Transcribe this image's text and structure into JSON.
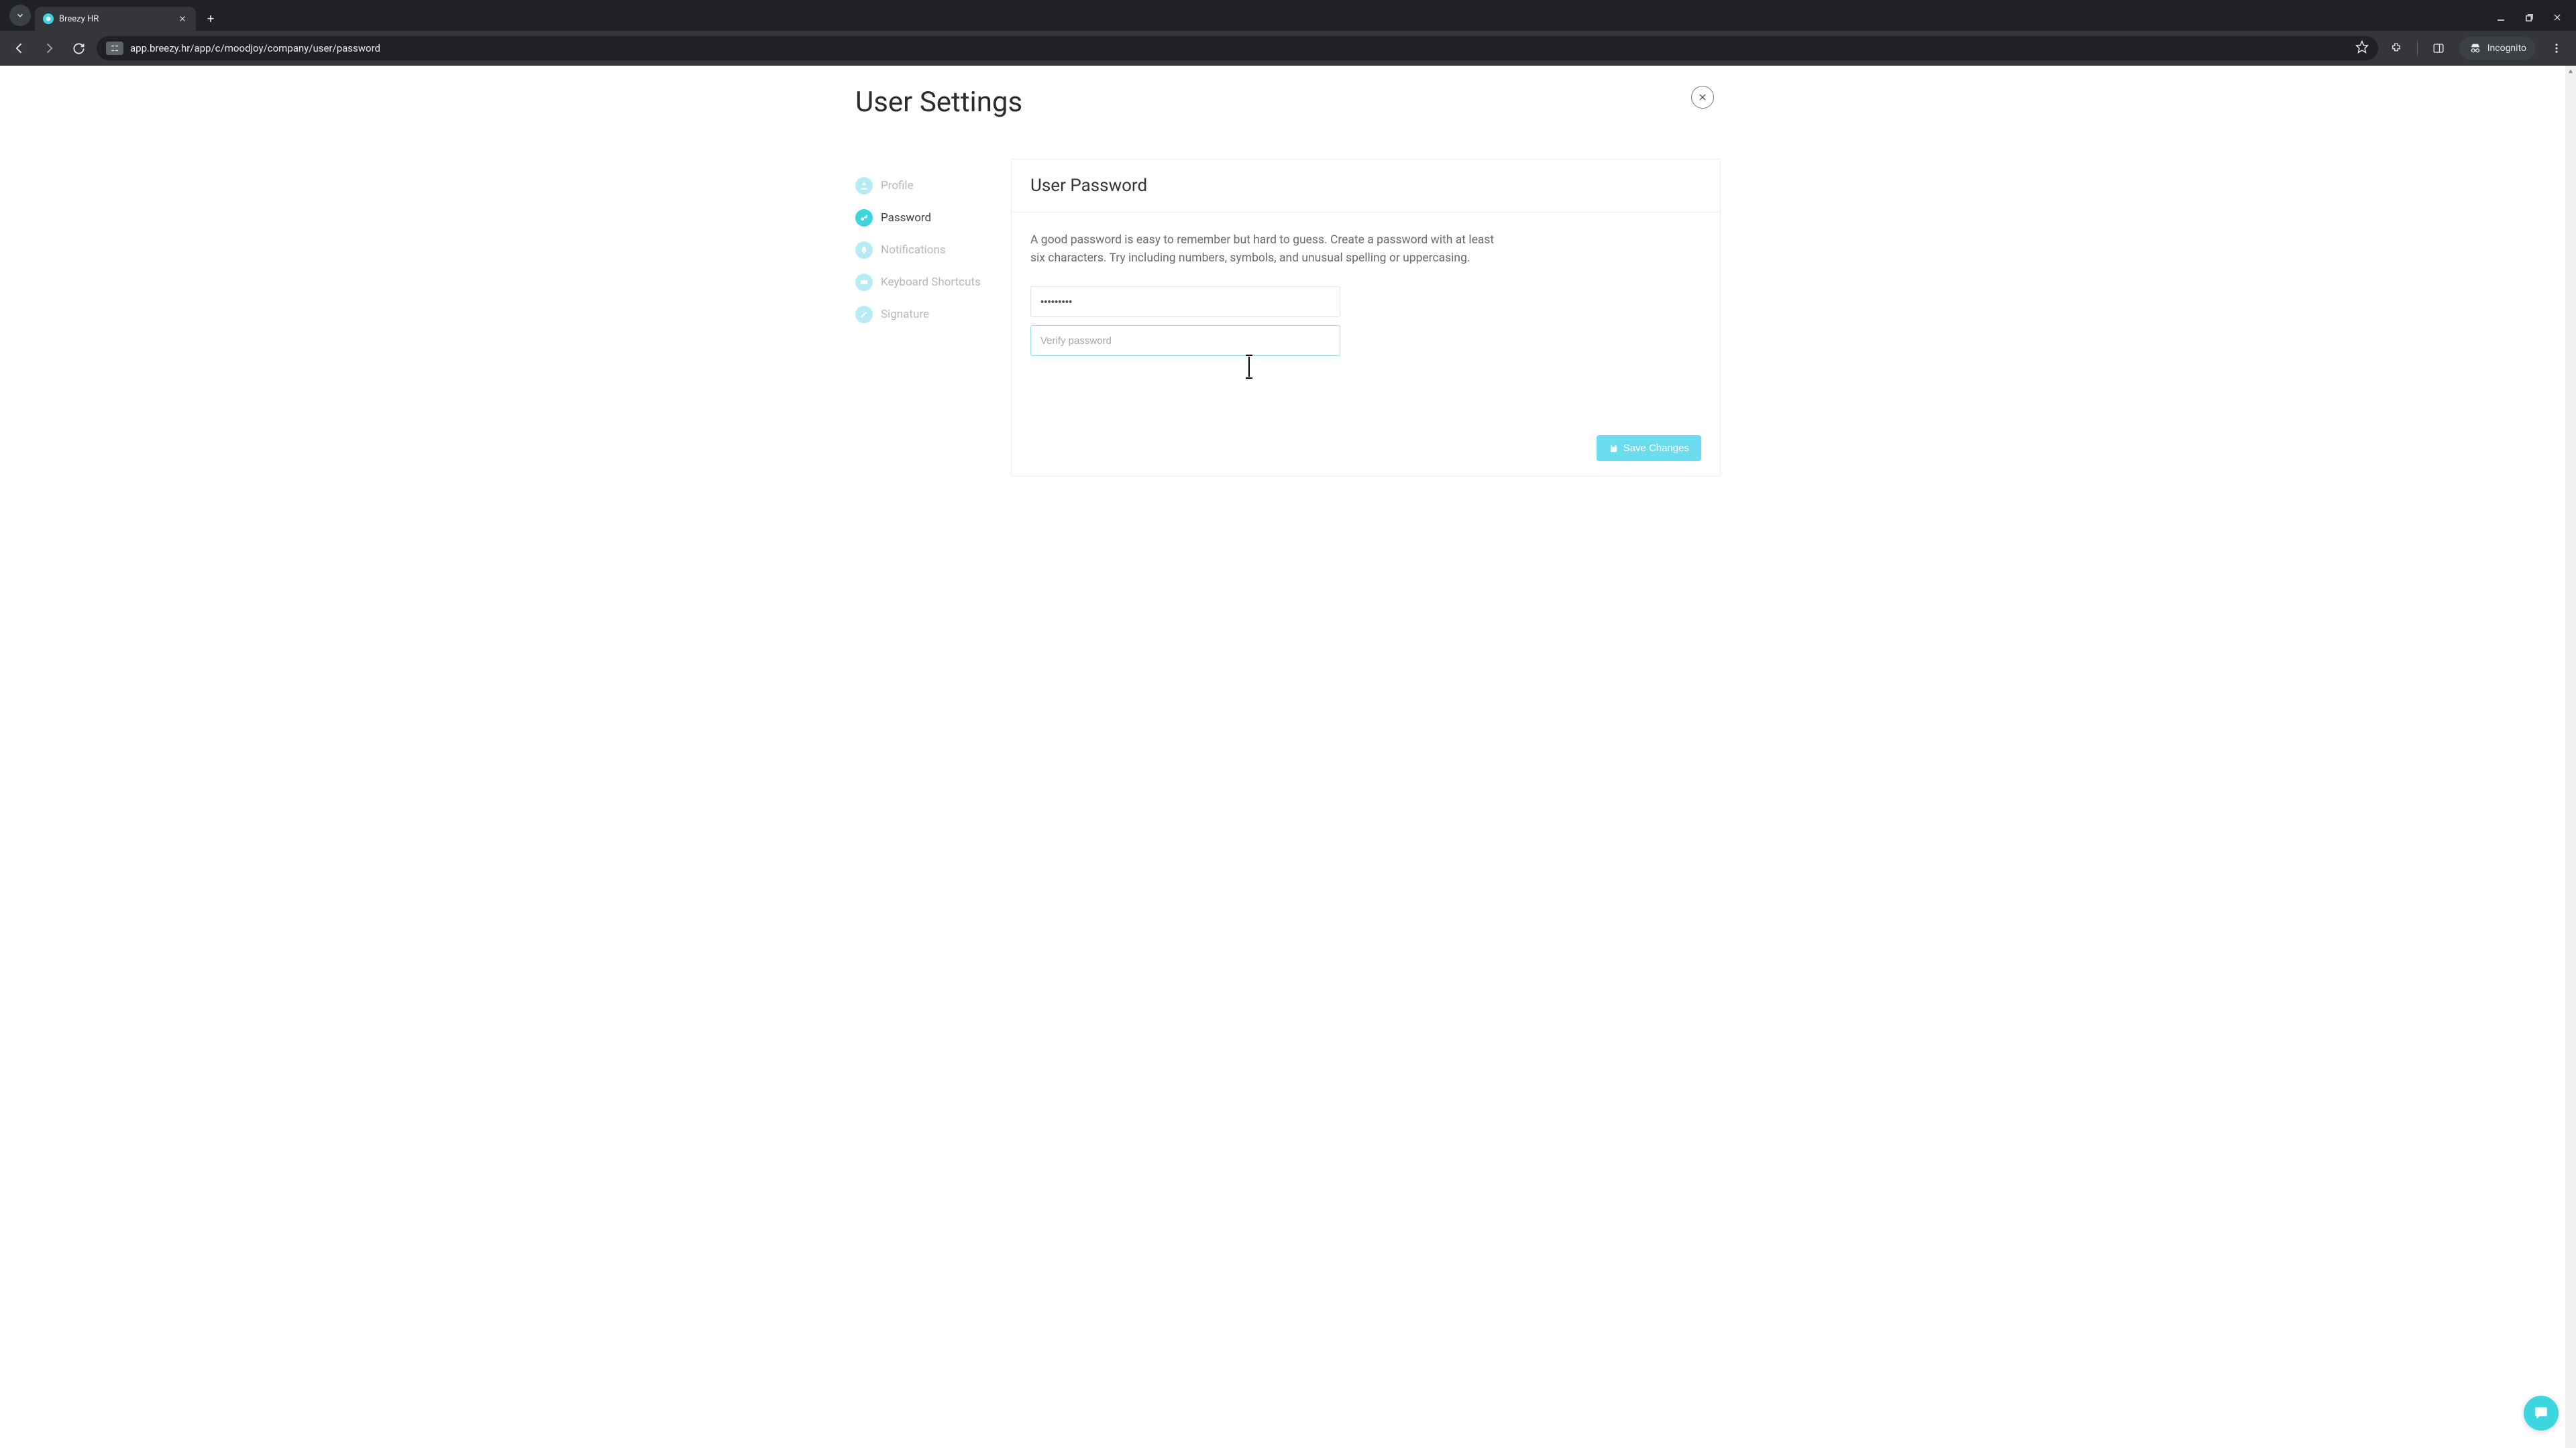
{
  "browser": {
    "tab_title": "Breezy HR",
    "url": "app.breezy.hr/app/c/moodjoy/company/user/password",
    "incognito_label": "Incognito"
  },
  "page": {
    "title": "User Settings"
  },
  "sidebar": {
    "items": [
      {
        "label": "Profile",
        "icon": "profile"
      },
      {
        "label": "Password",
        "icon": "key"
      },
      {
        "label": "Notifications",
        "icon": "bell"
      },
      {
        "label": "Keyboard Shortcuts",
        "icon": "keyboard"
      },
      {
        "label": "Signature",
        "icon": "pen"
      }
    ]
  },
  "panel": {
    "title": "User Password",
    "description": "A good password is easy to remember but hard to guess. Create a password with at least six characters. Try including numbers, symbols, and unusual spelling or uppercasing.",
    "password_value": "•••••••••",
    "verify_placeholder": "Verify password",
    "save_label": "Save Changes"
  }
}
